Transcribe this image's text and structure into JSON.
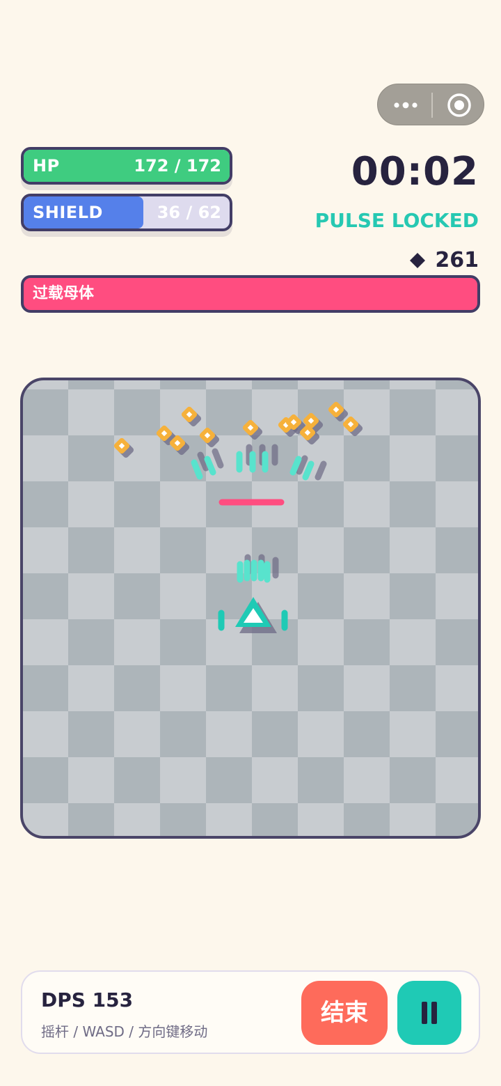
{
  "capsule": {
    "more_icon": "more-dots-icon",
    "target_icon": "target-circle-icon"
  },
  "hp": {
    "label": "HP",
    "value_text": "172 / 172",
    "current": 172,
    "max": 172,
    "color": "#3fcc80"
  },
  "shield": {
    "label": "SHIELD",
    "value_text": "36 / 62",
    "current": 36,
    "max": 62,
    "color": "#5580ea"
  },
  "timer": "00:02",
  "status": "PULSE LOCKED",
  "gems": {
    "icon": "diamond-icon",
    "count": "261"
  },
  "boss": {
    "name": "过载母体",
    "health_fraction": 1.0,
    "color": "#ff4d80"
  },
  "arena": {
    "player_icon": "triangle-ship-icon",
    "enemy_icon": "orange-diamond-enemy-icon",
    "colors": {
      "checker_dark": "#adb5ba",
      "checker_light": "#c8ccd0",
      "enemy": "#f6b13b",
      "projectile": "#58e3cd",
      "laser": "#ff4d80"
    }
  },
  "footer": {
    "dps": "DPS 153",
    "hint": "摇杆 / WASD / 方向键移动",
    "end_label": "结束",
    "pause_icon": "pause-icon"
  }
}
